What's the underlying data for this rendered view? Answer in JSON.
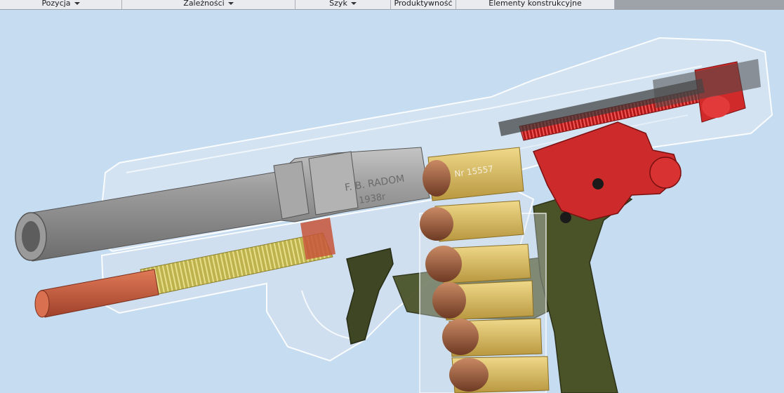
{
  "ribbon": {
    "panels": [
      {
        "label": "Pozycja",
        "has_dropdown": true
      },
      {
        "label": "Zależności",
        "has_dropdown": true
      },
      {
        "label": "Szyk",
        "has_dropdown": true
      },
      {
        "label": "Produktywność",
        "has_dropdown": false
      },
      {
        "label": "Elementy konstrukcyjne",
        "has_dropdown": false
      }
    ]
  },
  "model": {
    "engraving_line1": "F. B. RADOM",
    "engraving_line2": "1938r",
    "serial_text": "Nr 15557"
  },
  "colors": {
    "background": "#c6dcf1",
    "ribbon": "#e9ebee",
    "barrel": "#8f8f8f",
    "spring": "#c8c06a",
    "guide_rod": "#c8573a",
    "hammer": "#d02a2a",
    "grip_frame": "#434a26",
    "cartridge_case": "#d8bb5a",
    "bullet": "#9a5a3a"
  }
}
